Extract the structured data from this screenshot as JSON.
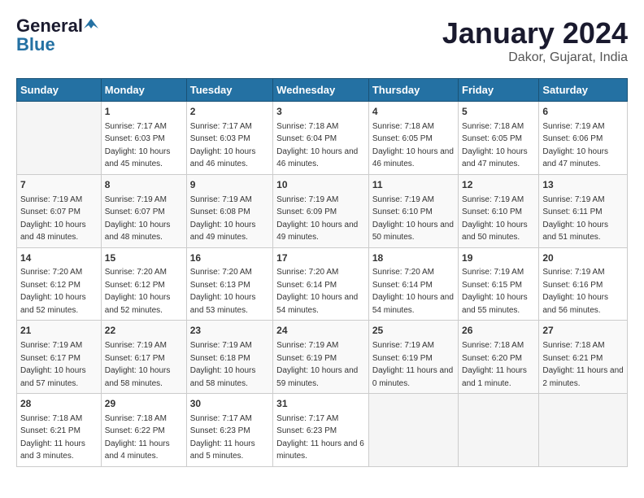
{
  "header": {
    "logo_general": "General",
    "logo_blue": "Blue",
    "month_title": "January 2024",
    "location": "Dakor, Gujarat, India"
  },
  "days_of_week": [
    "Sunday",
    "Monday",
    "Tuesday",
    "Wednesday",
    "Thursday",
    "Friday",
    "Saturday"
  ],
  "weeks": [
    [
      {
        "day": "",
        "sunrise": "",
        "sunset": "",
        "daylight": ""
      },
      {
        "day": "1",
        "sunrise": "Sunrise: 7:17 AM",
        "sunset": "Sunset: 6:03 PM",
        "daylight": "Daylight: 10 hours and 45 minutes."
      },
      {
        "day": "2",
        "sunrise": "Sunrise: 7:17 AM",
        "sunset": "Sunset: 6:03 PM",
        "daylight": "Daylight: 10 hours and 46 minutes."
      },
      {
        "day": "3",
        "sunrise": "Sunrise: 7:18 AM",
        "sunset": "Sunset: 6:04 PM",
        "daylight": "Daylight: 10 hours and 46 minutes."
      },
      {
        "day": "4",
        "sunrise": "Sunrise: 7:18 AM",
        "sunset": "Sunset: 6:05 PM",
        "daylight": "Daylight: 10 hours and 46 minutes."
      },
      {
        "day": "5",
        "sunrise": "Sunrise: 7:18 AM",
        "sunset": "Sunset: 6:05 PM",
        "daylight": "Daylight: 10 hours and 47 minutes."
      },
      {
        "day": "6",
        "sunrise": "Sunrise: 7:19 AM",
        "sunset": "Sunset: 6:06 PM",
        "daylight": "Daylight: 10 hours and 47 minutes."
      }
    ],
    [
      {
        "day": "7",
        "sunrise": "Sunrise: 7:19 AM",
        "sunset": "Sunset: 6:07 PM",
        "daylight": "Daylight: 10 hours and 48 minutes."
      },
      {
        "day": "8",
        "sunrise": "Sunrise: 7:19 AM",
        "sunset": "Sunset: 6:07 PM",
        "daylight": "Daylight: 10 hours and 48 minutes."
      },
      {
        "day": "9",
        "sunrise": "Sunrise: 7:19 AM",
        "sunset": "Sunset: 6:08 PM",
        "daylight": "Daylight: 10 hours and 49 minutes."
      },
      {
        "day": "10",
        "sunrise": "Sunrise: 7:19 AM",
        "sunset": "Sunset: 6:09 PM",
        "daylight": "Daylight: 10 hours and 49 minutes."
      },
      {
        "day": "11",
        "sunrise": "Sunrise: 7:19 AM",
        "sunset": "Sunset: 6:10 PM",
        "daylight": "Daylight: 10 hours and 50 minutes."
      },
      {
        "day": "12",
        "sunrise": "Sunrise: 7:19 AM",
        "sunset": "Sunset: 6:10 PM",
        "daylight": "Daylight: 10 hours and 50 minutes."
      },
      {
        "day": "13",
        "sunrise": "Sunrise: 7:19 AM",
        "sunset": "Sunset: 6:11 PM",
        "daylight": "Daylight: 10 hours and 51 minutes."
      }
    ],
    [
      {
        "day": "14",
        "sunrise": "Sunrise: 7:20 AM",
        "sunset": "Sunset: 6:12 PM",
        "daylight": "Daylight: 10 hours and 52 minutes."
      },
      {
        "day": "15",
        "sunrise": "Sunrise: 7:20 AM",
        "sunset": "Sunset: 6:12 PM",
        "daylight": "Daylight: 10 hours and 52 minutes."
      },
      {
        "day": "16",
        "sunrise": "Sunrise: 7:20 AM",
        "sunset": "Sunset: 6:13 PM",
        "daylight": "Daylight: 10 hours and 53 minutes."
      },
      {
        "day": "17",
        "sunrise": "Sunrise: 7:20 AM",
        "sunset": "Sunset: 6:14 PM",
        "daylight": "Daylight: 10 hours and 54 minutes."
      },
      {
        "day": "18",
        "sunrise": "Sunrise: 7:20 AM",
        "sunset": "Sunset: 6:14 PM",
        "daylight": "Daylight: 10 hours and 54 minutes."
      },
      {
        "day": "19",
        "sunrise": "Sunrise: 7:19 AM",
        "sunset": "Sunset: 6:15 PM",
        "daylight": "Daylight: 10 hours and 55 minutes."
      },
      {
        "day": "20",
        "sunrise": "Sunrise: 7:19 AM",
        "sunset": "Sunset: 6:16 PM",
        "daylight": "Daylight: 10 hours and 56 minutes."
      }
    ],
    [
      {
        "day": "21",
        "sunrise": "Sunrise: 7:19 AM",
        "sunset": "Sunset: 6:17 PM",
        "daylight": "Daylight: 10 hours and 57 minutes."
      },
      {
        "day": "22",
        "sunrise": "Sunrise: 7:19 AM",
        "sunset": "Sunset: 6:17 PM",
        "daylight": "Daylight: 10 hours and 58 minutes."
      },
      {
        "day": "23",
        "sunrise": "Sunrise: 7:19 AM",
        "sunset": "Sunset: 6:18 PM",
        "daylight": "Daylight: 10 hours and 58 minutes."
      },
      {
        "day": "24",
        "sunrise": "Sunrise: 7:19 AM",
        "sunset": "Sunset: 6:19 PM",
        "daylight": "Daylight: 10 hours and 59 minutes."
      },
      {
        "day": "25",
        "sunrise": "Sunrise: 7:19 AM",
        "sunset": "Sunset: 6:19 PM",
        "daylight": "Daylight: 11 hours and 0 minutes."
      },
      {
        "day": "26",
        "sunrise": "Sunrise: 7:18 AM",
        "sunset": "Sunset: 6:20 PM",
        "daylight": "Daylight: 11 hours and 1 minute."
      },
      {
        "day": "27",
        "sunrise": "Sunrise: 7:18 AM",
        "sunset": "Sunset: 6:21 PM",
        "daylight": "Daylight: 11 hours and 2 minutes."
      }
    ],
    [
      {
        "day": "28",
        "sunrise": "Sunrise: 7:18 AM",
        "sunset": "Sunset: 6:21 PM",
        "daylight": "Daylight: 11 hours and 3 minutes."
      },
      {
        "day": "29",
        "sunrise": "Sunrise: 7:18 AM",
        "sunset": "Sunset: 6:22 PM",
        "daylight": "Daylight: 11 hours and 4 minutes."
      },
      {
        "day": "30",
        "sunrise": "Sunrise: 7:17 AM",
        "sunset": "Sunset: 6:23 PM",
        "daylight": "Daylight: 11 hours and 5 minutes."
      },
      {
        "day": "31",
        "sunrise": "Sunrise: 7:17 AM",
        "sunset": "Sunset: 6:23 PM",
        "daylight": "Daylight: 11 hours and 6 minutes."
      },
      {
        "day": "",
        "sunrise": "",
        "sunset": "",
        "daylight": ""
      },
      {
        "day": "",
        "sunrise": "",
        "sunset": "",
        "daylight": ""
      },
      {
        "day": "",
        "sunrise": "",
        "sunset": "",
        "daylight": ""
      }
    ]
  ]
}
